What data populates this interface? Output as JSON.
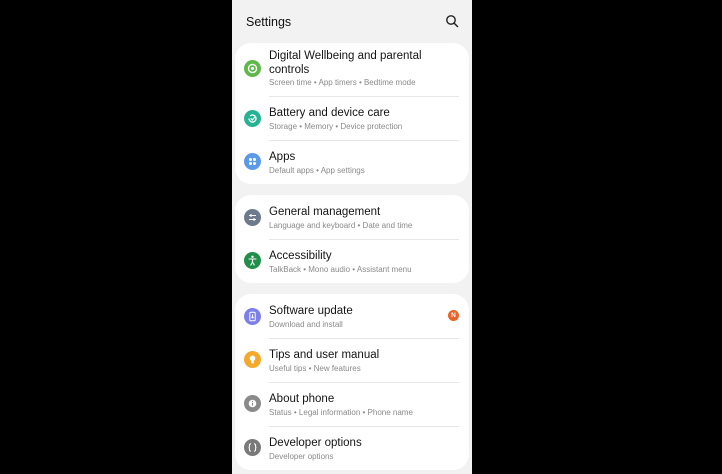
{
  "header": {
    "title": "Settings",
    "search_icon": "search-icon"
  },
  "colors": {
    "wellbeing": "#5fb84a",
    "battery": "#26b394",
    "apps": "#5b9be6",
    "general": "#6c7a8c",
    "accessibility": "#1f8f4a",
    "software": "#7d80e8",
    "tips": "#f4a92c",
    "about": "#8a8a8a",
    "developer": "#7a7a7a",
    "badge": "#e8622a"
  },
  "groups": [
    {
      "items": [
        {
          "title": "Digital Wellbeing and parental controls",
          "subtitle": "Screen time  •  App timers  •  Bedtime mode",
          "icon": "wellbeing-icon"
        },
        {
          "title": "Battery and device care",
          "subtitle": "Storage  •  Memory  •  Device protection",
          "icon": "device-care-icon"
        },
        {
          "title": "Apps",
          "subtitle": "Default apps  •  App settings",
          "icon": "apps-grid-icon"
        }
      ]
    },
    {
      "items": [
        {
          "title": "General management",
          "subtitle": "Language and keyboard  •  Date and time",
          "icon": "sliders-icon"
        },
        {
          "title": "Accessibility",
          "subtitle": "TalkBack  •  Mono audio  •  Assistant menu",
          "icon": "accessibility-person-icon"
        }
      ]
    },
    {
      "items": [
        {
          "title": "Software update",
          "subtitle": "Download and install",
          "icon": "software-update-icon",
          "badge": "N"
        },
        {
          "title": "Tips and user manual",
          "subtitle": "Useful tips  •  New features",
          "icon": "lightbulb-icon"
        },
        {
          "title": "About phone",
          "subtitle": "Status  •  Legal information  •  Phone name",
          "icon": "info-icon"
        },
        {
          "title": "Developer options",
          "subtitle": "Developer options",
          "icon": "developer-braces-icon"
        }
      ]
    }
  ]
}
